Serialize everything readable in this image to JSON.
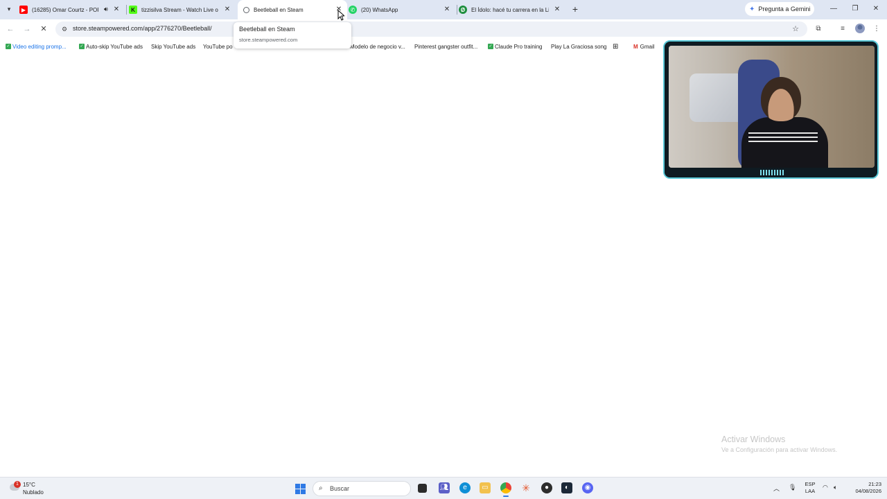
{
  "browser": {
    "tabs": [
      {
        "title": "(16285) Omar Courtz - POR",
        "icon": "youtube-icon",
        "color": "#ff0000"
      },
      {
        "title": "tizzisilva Stream - Watch Live o",
        "icon": "kick-icon",
        "color": "#53fc18"
      },
      {
        "title": "Beetleball en Steam",
        "icon": "loading-icon",
        "color": "#5f6368"
      },
      {
        "title": "(20) WhatsApp",
        "icon": "whatsapp-icon",
        "color": "#25d366"
      },
      {
        "title": "El Ídolo: hacé tu carrera en la Li",
        "icon": "idolo-icon",
        "color": "#1e8e3e"
      }
    ],
    "new_tab": "+",
    "gemini_label": "Pregunta a Gemini",
    "url": "store.steampowered.com/app/2776270/Beetleball/",
    "hover_card": {
      "title": "Beetleball en Steam",
      "domain": "store.steampowered.com"
    },
    "bookmarks": [
      {
        "label": "Video editing promp...",
        "checked": true
      },
      {
        "label": "Auto-skip YouTube ads",
        "checked": true
      },
      {
        "label": "Skip YouTube ads",
        "checked": false
      },
      {
        "label": "YouTube po",
        "checked": false
      },
      {
        "label": "Modelo de negocio v...",
        "checked": false
      },
      {
        "label": "Pinterest gangster outfit...",
        "checked": false
      },
      {
        "label": "Claude Pro training",
        "checked": true
      },
      {
        "label": "Play La Graciosa song",
        "checked": false
      },
      {
        "label": "Gmail",
        "checked": false
      }
    ]
  },
  "watermark": {
    "line1": "Activar Windows",
    "line2": "Ve a Configuración para activar Windows."
  },
  "taskbar": {
    "weather_temp": "15°C",
    "weather_cond": "Nublado",
    "weather_badge": "1",
    "search_label": "Buscar",
    "lang_line1": "ESP",
    "lang_line2": "LAA",
    "time": "21:23",
    "date": "04/08/2026"
  },
  "colors": {
    "tabstrip": "#dfe6f3",
    "accent": "#2f7ae5",
    "webcam_border": "#5ac8d8"
  }
}
